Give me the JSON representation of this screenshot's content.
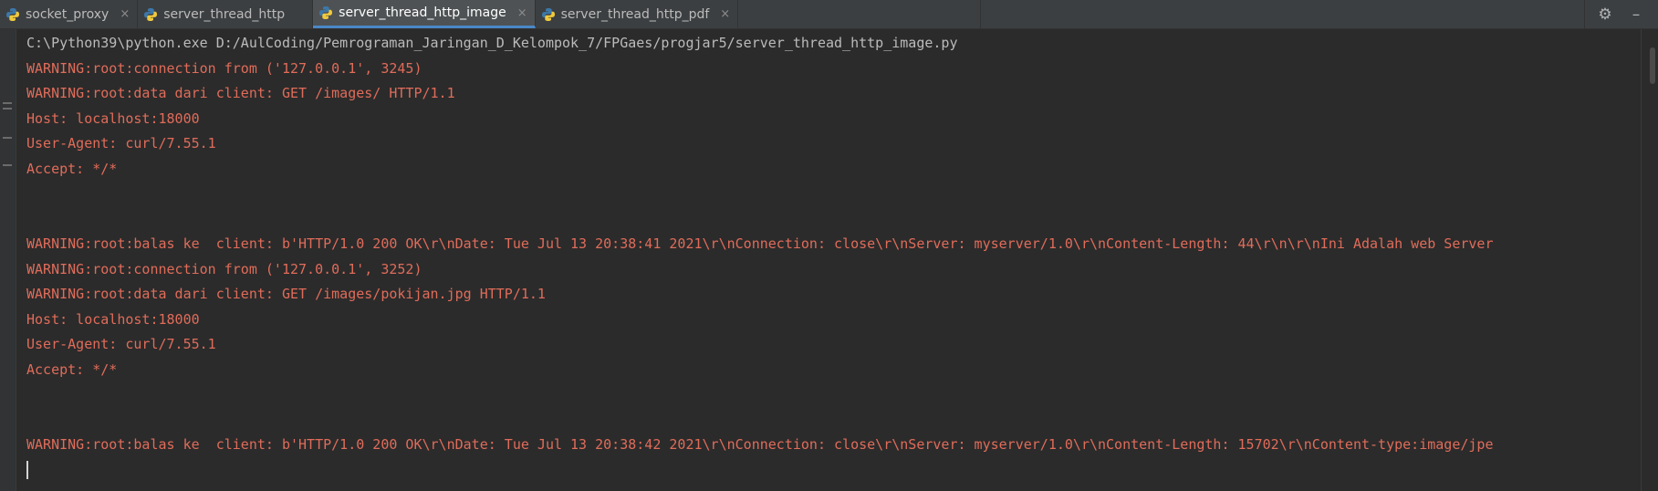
{
  "tabs": [
    {
      "label": "socket_proxy",
      "close": "×",
      "active": false
    },
    {
      "label": "server_thread_http",
      "close": "",
      "active": false
    },
    {
      "label": "server_thread_http_image",
      "close": "×",
      "active": true
    },
    {
      "label": "server_thread_http_pdf",
      "close": "×",
      "active": false
    }
  ],
  "toolbar": {
    "settings_icon": "⚙",
    "minimize_icon": "–"
  },
  "colors": {
    "background": "#2b2b2b",
    "warning_text": "#e06c5a",
    "command_text": "#bbbbbb",
    "active_tab_underline": "#4a88c7"
  },
  "console": {
    "lines": [
      {
        "type": "cmd",
        "text": "C:\\Python39\\python.exe D:/AulCoding/Pemrograman_Jaringan_D_Kelompok_7/FPGaes/progjar5/server_thread_http_image.py"
      },
      {
        "type": "warn",
        "text": "WARNING:root:connection from ('127.0.0.1', 3245)"
      },
      {
        "type": "warn",
        "text": "WARNING:root:data dari client: GET /images/ HTTP/1.1"
      },
      {
        "type": "warn",
        "text": "Host: localhost:18000"
      },
      {
        "type": "warn",
        "text": "User-Agent: curl/7.55.1"
      },
      {
        "type": "warn",
        "text": "Accept: */*"
      },
      {
        "type": "warn",
        "text": ""
      },
      {
        "type": "warn",
        "text": ""
      },
      {
        "type": "warn",
        "text": "WARNING:root:balas ke  client: b'HTTP/1.0 200 OK\\r\\nDate: Tue Jul 13 20:38:41 2021\\r\\nConnection: close\\r\\nServer: myserver/1.0\\r\\nContent-Length: 44\\r\\n\\r\\nIni Adalah web Server"
      },
      {
        "type": "warn",
        "text": "WARNING:root:connection from ('127.0.0.1', 3252)"
      },
      {
        "type": "warn",
        "text": "WARNING:root:data dari client: GET /images/pokijan.jpg HTTP/1.1"
      },
      {
        "type": "warn",
        "text": "Host: localhost:18000"
      },
      {
        "type": "warn",
        "text": "User-Agent: curl/7.55.1"
      },
      {
        "type": "warn",
        "text": "Accept: */*"
      },
      {
        "type": "warn",
        "text": ""
      },
      {
        "type": "warn",
        "text": ""
      },
      {
        "type": "warn",
        "text": "WARNING:root:balas ke  client: b'HTTP/1.0 200 OK\\r\\nDate: Tue Jul 13 20:38:42 2021\\r\\nConnection: close\\r\\nServer: myserver/1.0\\r\\nContent-Length: 15702\\r\\nContent-type:image/jpe"
      }
    ]
  }
}
